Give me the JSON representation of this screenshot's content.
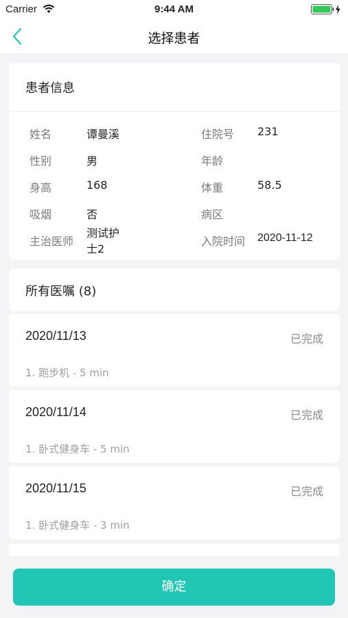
{
  "status_bar": {
    "carrier": "Carrier",
    "time": "9:44 AM"
  },
  "nav": {
    "title": "选择患者"
  },
  "patient_info": {
    "section_title": "患者信息",
    "fields": [
      {
        "label": "姓名",
        "value": "谭曼溪"
      },
      {
        "label": "住院号",
        "value": "231"
      },
      {
        "label": "性别",
        "value": "男"
      },
      {
        "label": "年龄",
        "value": ""
      },
      {
        "label": "身高",
        "value": "168"
      },
      {
        "label": "体重",
        "value": "58.5"
      },
      {
        "label": "吸烟",
        "value": "否"
      },
      {
        "label": "病区",
        "value": ""
      },
      {
        "label": "主治医师",
        "value_line1": "测试护",
        "value_line2": "士2"
      },
      {
        "label": "入院时间",
        "value": "2020-11-12"
      }
    ]
  },
  "orders": {
    "title": "所有医嘱 (8)",
    "list": [
      {
        "date": "2020/11/13",
        "status": "已完成",
        "item": "1. 跑步机 - 5 min"
      },
      {
        "date": "2020/11/14",
        "status": "已完成",
        "item": "1. 卧式健身车 - 5 min"
      },
      {
        "date": "2020/11/15",
        "status": "已完成",
        "item": "1. 卧式健身车 - 3 min"
      }
    ]
  },
  "footer": {
    "confirm_label": "确定"
  },
  "colors": {
    "accent": "#22c6b5",
    "background": "#f4f4f6"
  },
  "icons": {
    "back": "chevron-left-icon",
    "wifi": "wifi-icon",
    "battery": "battery-icon",
    "charging": "charging-bolt-icon"
  }
}
